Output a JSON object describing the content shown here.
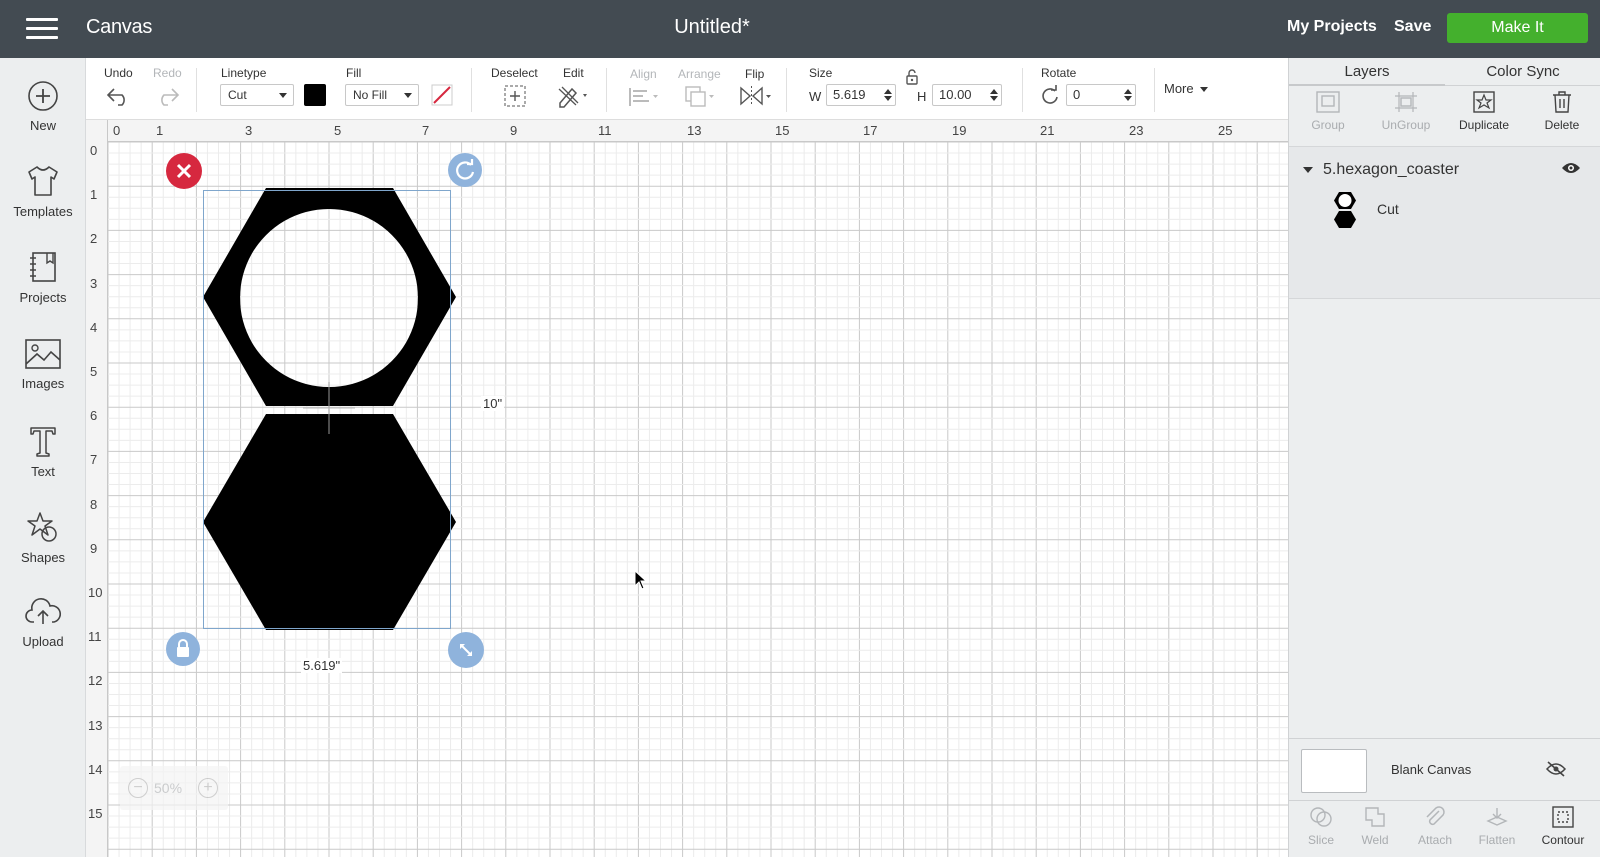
{
  "header": {
    "app_title": "Canvas",
    "document_title": "Untitled*",
    "my_projects": "My Projects",
    "save": "Save",
    "make_it": "Make It",
    "make_it_color": "#44b02d",
    "bar_color": "#434b52"
  },
  "sidebar": {
    "items": [
      {
        "label": "New",
        "icon": "plus-circle-icon"
      },
      {
        "label": "Templates",
        "icon": "tshirt-icon"
      },
      {
        "label": "Projects",
        "icon": "notebook-icon"
      },
      {
        "label": "Images",
        "icon": "image-icon"
      },
      {
        "label": "Text",
        "icon": "text-t-icon"
      },
      {
        "label": "Shapes",
        "icon": "shapes-icon"
      },
      {
        "label": "Upload",
        "icon": "cloud-upload-icon"
      }
    ]
  },
  "toolbar": {
    "undo": "Undo",
    "redo": "Redo",
    "linetype_label": "Linetype",
    "linetype_value": "Cut",
    "linetype_color": "#000000",
    "fill_label": "Fill",
    "fill_value": "No Fill",
    "deselect": "Deselect",
    "edit": "Edit",
    "align": "Align",
    "arrange": "Arrange",
    "flip": "Flip",
    "size_label": "Size",
    "w_label": "W",
    "w_value": "5.619",
    "h_label": "H",
    "h_value": "10.00",
    "rotate_label": "Rotate",
    "rotate_value": "0",
    "more": "More"
  },
  "layers_panel": {
    "tabs": [
      "Layers",
      "Color Sync"
    ],
    "actions": [
      {
        "label": "Group",
        "enabled": false
      },
      {
        "label": "UnGroup",
        "enabled": false
      },
      {
        "label": "Duplicate",
        "enabled": true
      },
      {
        "label": "Delete",
        "enabled": true
      }
    ],
    "layer_name": "5.hexagon_coaster",
    "layer_op": "Cut",
    "blank_canvas": "Blank Canvas",
    "bottom_actions": [
      {
        "label": "Slice",
        "enabled": false
      },
      {
        "label": "Weld",
        "enabled": false
      },
      {
        "label": "Attach",
        "enabled": false
      },
      {
        "label": "Flatten",
        "enabled": false
      },
      {
        "label": "Contour",
        "enabled": true
      }
    ]
  },
  "canvas": {
    "h_ruler": [
      "0",
      "1",
      "3",
      "5",
      "7",
      "9",
      "11",
      "13",
      "15",
      "17",
      "19",
      "21",
      "23",
      "25"
    ],
    "v_ruler": [
      "0",
      "1",
      "2",
      "3",
      "4",
      "5",
      "6",
      "7",
      "8",
      "9",
      "10",
      "11",
      "12",
      "13",
      "14",
      "15"
    ],
    "dim_height": "10\"",
    "dim_width": "5.619\"",
    "zoom_minus": "−",
    "zoom": "50%",
    "zoom_plus": "+"
  }
}
